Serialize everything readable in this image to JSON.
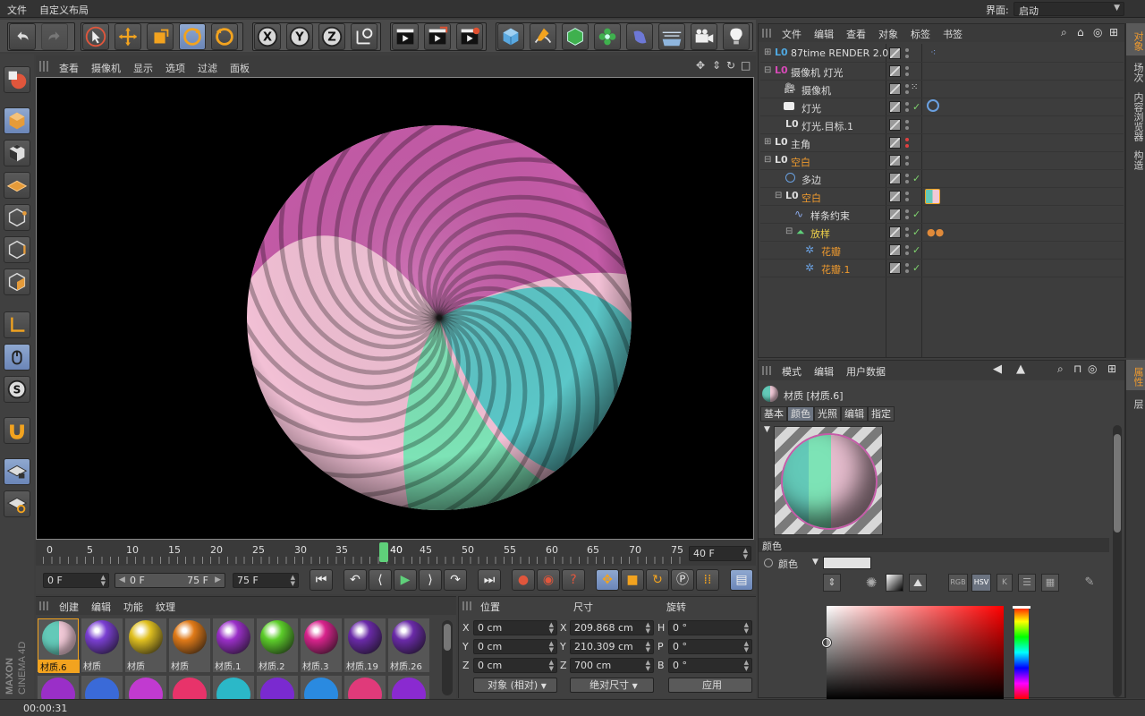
{
  "menubar": {
    "file": "文件",
    "layout": "自定义布局",
    "interface_label": "界面:",
    "interface_value": "启动"
  },
  "viewport": {
    "menu": [
      "查看",
      "摄像机",
      "显示",
      "选项",
      "过滤",
      "面板"
    ]
  },
  "timeline": {
    "ticks": [
      "0",
      "5",
      "10",
      "15",
      "20",
      "25",
      "30",
      "35",
      "40",
      "45",
      "50",
      "55",
      "60",
      "65",
      "70",
      "75"
    ],
    "current_marker": "40",
    "end_field": "40 F",
    "start_field": "0 F",
    "range_start": "0 F",
    "range_end": "75 F",
    "max_field": "75 F"
  },
  "objects": {
    "menu": [
      "文件",
      "编辑",
      "查看",
      "对象",
      "标签",
      "书签"
    ],
    "rows": [
      {
        "name": "87time RENDER 2.0"
      },
      {
        "name": "摄像机 灯光"
      },
      {
        "name": "摄像机"
      },
      {
        "name": "灯光"
      },
      {
        "name": "灯光.目标.1"
      },
      {
        "name": "主角"
      },
      {
        "name": "空白"
      },
      {
        "name": "多边"
      },
      {
        "name": "空白"
      },
      {
        "name": "样条约束"
      },
      {
        "name": "放样"
      },
      {
        "name": "花瓣"
      },
      {
        "name": "花瓣.1"
      }
    ]
  },
  "right_tabs_top": [
    "对象",
    "场次",
    "内容浏览器",
    "构造"
  ],
  "right_tabs_bottom": [
    "属性",
    "层"
  ],
  "attributes": {
    "menu": [
      "模式",
      "编辑",
      "用户数据"
    ],
    "title": "材质 [材质.6]",
    "tabs": [
      "基本",
      "颜色",
      "光照",
      "编辑",
      "指定"
    ],
    "section": "颜色",
    "color_label": "颜色",
    "mode_rgb": "RGB",
    "mode_hsv": "HSV",
    "mode_k": "K"
  },
  "materials": {
    "menu": [
      "创建",
      "编辑",
      "功能",
      "纹理"
    ],
    "items": [
      {
        "name": "材质.6",
        "color": "#63c9b8"
      },
      {
        "name": "材质",
        "color": "#7a3fd2"
      },
      {
        "name": "材质",
        "color": "#e0c020"
      },
      {
        "name": "材质",
        "color": "#e07a18"
      },
      {
        "name": "材质.1",
        "color": "#9a2fc8"
      },
      {
        "name": "材质.2",
        "color": "#5ccd2a"
      },
      {
        "name": "材质.3",
        "color": "#d8238c"
      },
      {
        "name": "材质.19",
        "color": "#6a2aa8"
      },
      {
        "name": "材质.26",
        "color": "#6a2aa8"
      }
    ]
  },
  "coords": {
    "headers": [
      "位置",
      "尺寸",
      "旋转"
    ],
    "rows": [
      {
        "axis": "X",
        "pos": "0 cm",
        "size_axis": "X",
        "size": "209.868 cm",
        "rot_axis": "H",
        "rot": "0 °"
      },
      {
        "axis": "Y",
        "pos": "0 cm",
        "size_axis": "Y",
        "size": "210.309 cm",
        "rot_axis": "P",
        "rot": "0 °"
      },
      {
        "axis": "Z",
        "pos": "0 cm",
        "size_axis": "Z",
        "size": "700 cm",
        "rot_axis": "B",
        "rot": "0 °"
      }
    ],
    "mode_select": "对象 (相对)",
    "size_select": "绝对尺寸",
    "apply": "应用"
  },
  "statusbar": {
    "time": "00:00:31"
  },
  "brand": {
    "line1": "MAXON",
    "line2": "CINEMA 4D"
  }
}
